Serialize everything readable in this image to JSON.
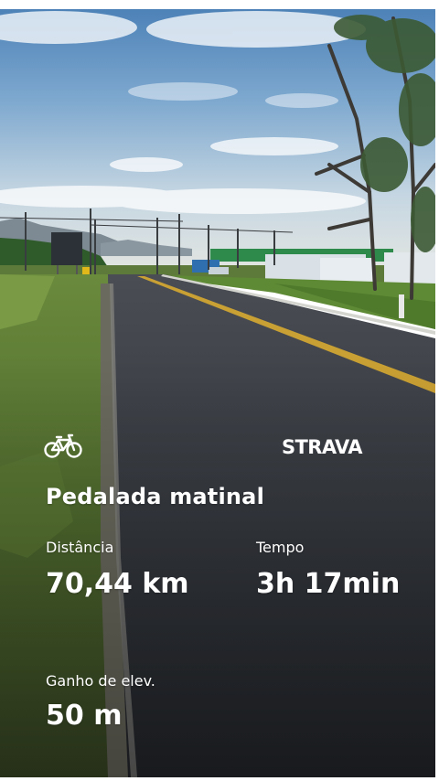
{
  "scene": {
    "description_icon": "bike-icon",
    "brand_color": "#ffffff"
  },
  "activity": {
    "logo_text": "STRAVA",
    "title": "Pedalada matinal"
  },
  "stats": {
    "distance_label": "Distância",
    "distance_value": "70,44 km",
    "time_label": "Tempo",
    "time_value": "3h 17min",
    "elevation_label": "Ganho de elev.",
    "elevation_value": "50 m"
  }
}
